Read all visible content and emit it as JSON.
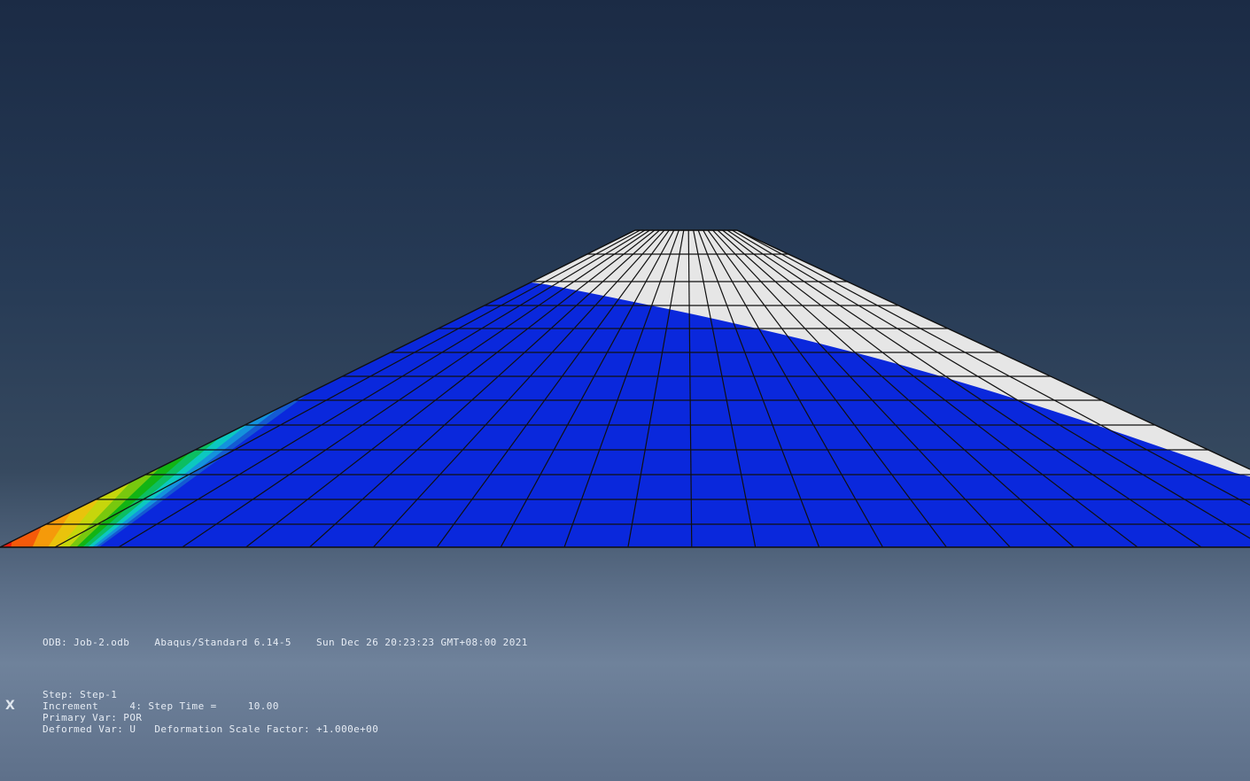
{
  "viewport": {
    "background_top": "#1b2b45",
    "background_bottom": "#6f829b",
    "mesh_line_color": "#101010"
  },
  "contour": {
    "primary_variable": "POR",
    "band_colors": [
      "#ee1c0c",
      "#f45a0a",
      "#f59a0a",
      "#e9c30c",
      "#c6d60c",
      "#78c80e",
      "#12b414",
      "#0cbe62",
      "#0cc8c0",
      "#1492dc",
      "#145ad2",
      "#0a28dc"
    ],
    "uncovered_color": "#e6e6e6"
  },
  "triad": {
    "axis_label": "X"
  },
  "info": {
    "odb_line": "ODB: Job-2.odb    Abaqus/Standard 6.14-5    Sun Dec 26 20:23:23 GMT+08:00 2021",
    "step_line": "Step: Step-1",
    "increment_line": "Increment     4: Step Time =     10.00",
    "primary_var_line": "Primary Var: POR",
    "deformed_var_line": "Deformed Var: U   Deformation Scale Factor: +1.000e+00"
  }
}
